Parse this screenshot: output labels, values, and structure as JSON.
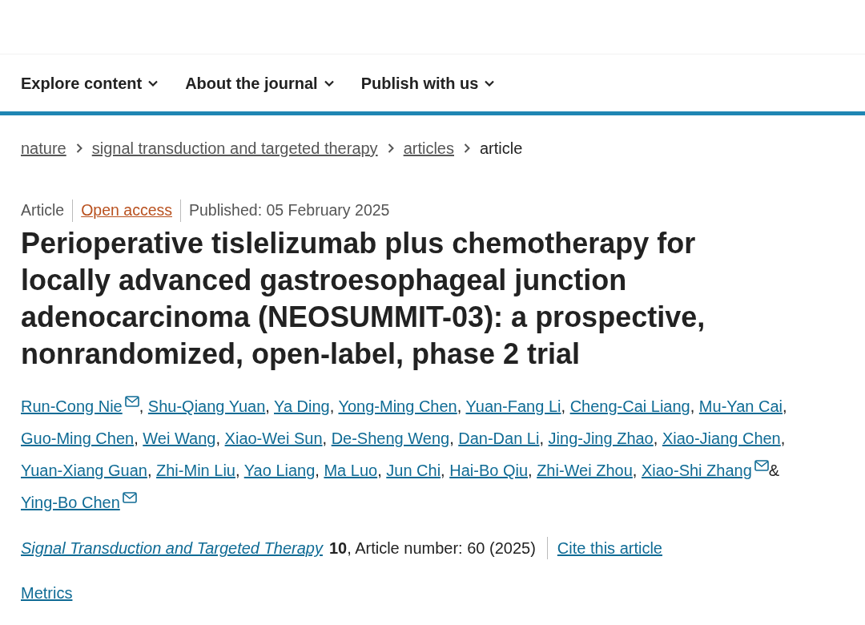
{
  "nav": {
    "items": [
      {
        "label": "Explore content"
      },
      {
        "label": "About the journal"
      },
      {
        "label": "Publish with us"
      }
    ]
  },
  "breadcrumb": {
    "links": [
      "nature",
      "signal transduction and targeted therapy",
      "articles"
    ],
    "current": "article"
  },
  "meta": {
    "type": "Article",
    "access": "Open access",
    "published": "Published: 05 February 2025"
  },
  "title": "Perioperative tislelizumab plus chemotherapy for locally advanced gastroesophageal junction adenocarcinoma (NEOSUMMIT-03): a prospective, nonrandomized, open-label, phase 2 trial",
  "author_lines": [
    [
      {
        "name": "Run-Cong Nie",
        "email": true,
        "after": ","
      },
      {
        "name": "Shu-Qiang Yuan",
        "email": false,
        "after": ","
      },
      {
        "name": "Ya Ding",
        "email": false,
        "after": ","
      },
      {
        "name": "Yong-Ming Chen",
        "email": false,
        "after": ","
      },
      {
        "name": "Yuan-Fang Li",
        "email": false,
        "after": ","
      },
      {
        "name": "Cheng-Cai Liang",
        "email": false,
        "after": ","
      },
      {
        "name": "Mu-Yan Cai",
        "email": false,
        "after": ","
      }
    ],
    [
      {
        "name": "Guo-Ming Chen",
        "email": false,
        "after": ","
      },
      {
        "name": "Wei Wang",
        "email": false,
        "after": ","
      },
      {
        "name": "Xiao-Wei Sun",
        "email": false,
        "after": ","
      },
      {
        "name": "De-Sheng Weng",
        "email": false,
        "after": ","
      },
      {
        "name": "Dan-Dan Li",
        "email": false,
        "after": ","
      },
      {
        "name": "Jing-Jing Zhao",
        "email": false,
        "after": ","
      },
      {
        "name": "Xiao-Jiang Chen",
        "email": false,
        "after": ","
      }
    ],
    [
      {
        "name": "Yuan-Xiang Guan",
        "email": false,
        "after": ","
      },
      {
        "name": "Zhi-Min Liu",
        "email": false,
        "after": ","
      },
      {
        "name": "Yao Liang",
        "email": false,
        "after": ","
      },
      {
        "name": "Ma Luo",
        "email": false,
        "after": ","
      },
      {
        "name": "Jun Chi",
        "email": false,
        "after": ","
      },
      {
        "name": "Hai-Bo Qiu",
        "email": false,
        "after": ","
      },
      {
        "name": "Zhi-Wei Zhou",
        "email": false,
        "after": ","
      },
      {
        "name": "Xiao-Shi Zhang",
        "email": true,
        "after": "&"
      }
    ],
    [
      {
        "name": "Ying-Bo Chen",
        "email": true
      }
    ]
  ],
  "citation": {
    "journal": "Signal Transduction and Targeted Therapy",
    "details": "**10**, Article number: 60 (2025)",
    "cite": "Cite this article"
  },
  "metrics": "Metrics"
}
